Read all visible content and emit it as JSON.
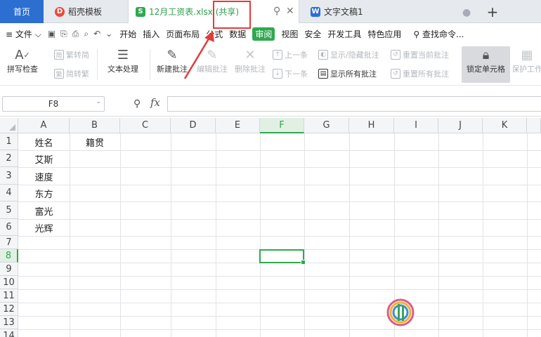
{
  "tabs": {
    "home": "首页",
    "docer": "稻壳模板",
    "file": "12月工资表.xlsx (共享)",
    "doc": "文字文稿1",
    "add": "+",
    "pin": "⚲",
    "close": "✕",
    "dot": "●"
  },
  "menu": {
    "file": "文件",
    "items": [
      "开始",
      "插入",
      "页面布局",
      "公式",
      "数据",
      "审阅",
      "视图",
      "安全",
      "开发工具",
      "特色应用"
    ],
    "active": "审阅",
    "search": "查找命令..."
  },
  "ribbon": {
    "spellcheck": "拼写检查",
    "trad": "繁转简",
    "simp": "简转繁",
    "text_proc": "文本处理",
    "new_comment": "新建批注",
    "edit_comment": "编辑批注",
    "delete_comment": "删除批注",
    "prev": "上一条",
    "next": "下一条",
    "show_hide": "显示/隐藏批注",
    "show_all": "显示所有批注",
    "reset_current": "重置当前批注",
    "reset_all": "重置所有批注",
    "lock_cell": "锁定单元格",
    "protect": "保护工作"
  },
  "formula_bar": {
    "cell_ref": "F8",
    "fx": "fx",
    "value": ""
  },
  "sheet": {
    "columns": [
      "A",
      "B",
      "C",
      "D",
      "E",
      "F",
      "G",
      "H",
      "I",
      "J",
      "K"
    ],
    "rows": [
      "1",
      "2",
      "3",
      "4",
      "5",
      "6",
      "7",
      "8",
      "9",
      "10",
      "11",
      "12",
      "13",
      "14"
    ],
    "cells": {
      "A1": "姓名",
      "B1": "籍贯",
      "A2": "艾斯",
      "A3": "速度",
      "A4": "东方",
      "A5": "富光",
      "A6": "光辉"
    },
    "selected": "F8"
  },
  "colors": {
    "accent": "#2fa84f",
    "home_tab": "#2c6fd1",
    "highlight": "#e23b3b"
  }
}
